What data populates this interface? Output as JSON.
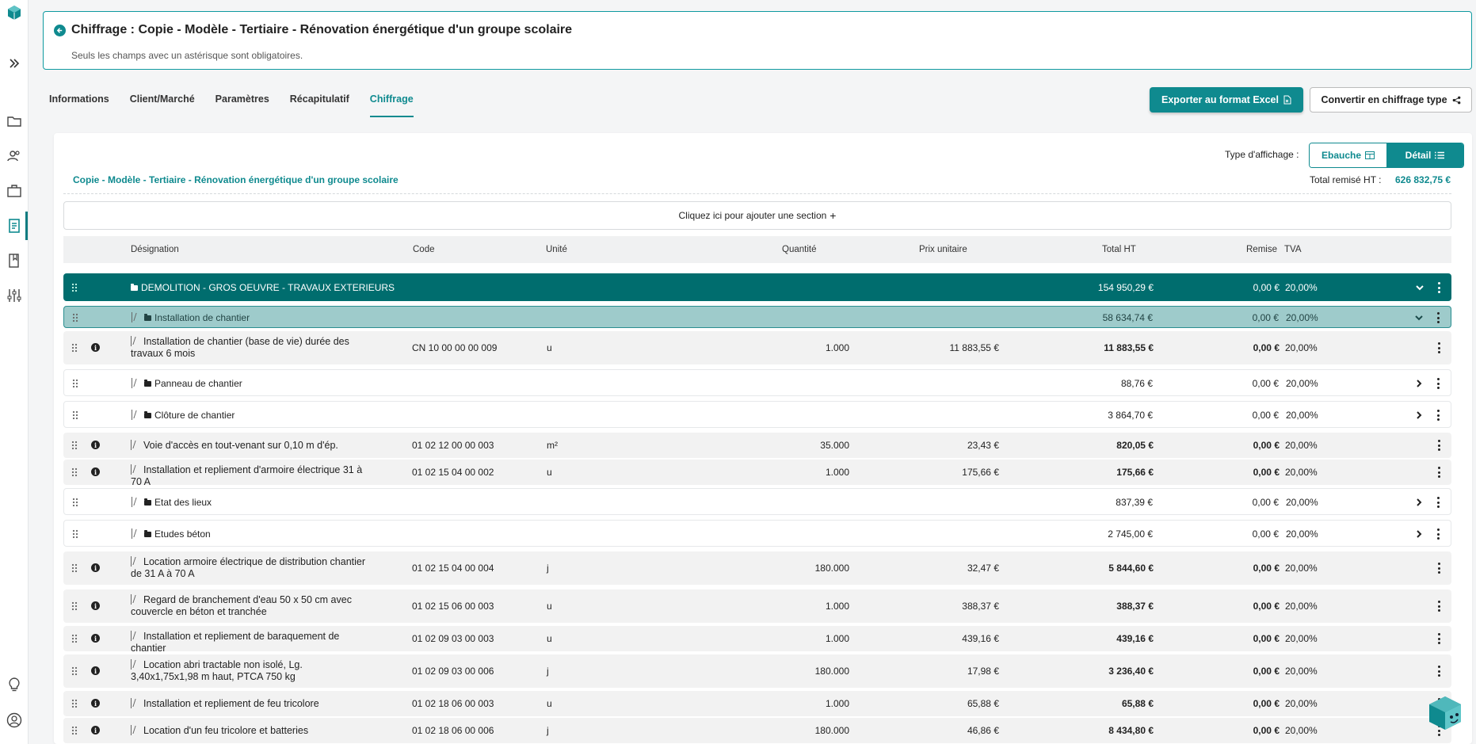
{
  "header": {
    "title": "Chiffrage : Copie - Modèle - Tertiaire - Rénovation énergétique d'un groupe scolaire",
    "subtitle": "Seuls les champs avec un astérisque sont obligatoires."
  },
  "tabs": [
    {
      "label": "Informations"
    },
    {
      "label": "Client/Marché"
    },
    {
      "label": "Paramètres"
    },
    {
      "label": "Récapitulatif"
    },
    {
      "label": "Chiffrage",
      "active": true
    }
  ],
  "toolbar": {
    "export_label": "Exporter au format Excel",
    "convert_label": "Convertir en chiffrage type"
  },
  "display": {
    "label": "Type d'affichage :",
    "option_draft": "Ebauche",
    "option_detail": "Détail",
    "selected": "Détail"
  },
  "project": {
    "name": "Copie - Modèle - Tertiaire - Rénovation énergétique d'un groupe scolaire",
    "total_label": "Total remisé HT :",
    "total_value": "626 832,75 €"
  },
  "add_section_label": "Cliquez ici pour ajouter une section",
  "columns": {
    "designation": "Désignation",
    "code": "Code",
    "unit": "Unité",
    "qty": "Quantité",
    "price": "Prix unitaire",
    "total": "Total HT",
    "discount": "Remise",
    "vat": "TVA"
  },
  "rows": [
    {
      "type": "section",
      "designation": "DEMOLITION - GROS OEUVRE - TRAVAUX EXTERIEURS",
      "total": "154 950,29 €",
      "discount": "0,00 €",
      "vat": "20,00%"
    },
    {
      "type": "subsection",
      "designation": "Installation de chantier",
      "total": "58 634,74 €",
      "discount": "0,00 €",
      "vat": "20,00%"
    },
    {
      "type": "item",
      "designation": "Installation de chantier (base de vie) durée des travaux 6 mois",
      "code": "CN 10 00 00 00 009",
      "unit": "u",
      "qty": "1.000",
      "price": "11 883,55 €",
      "total": "11 883,55 €",
      "discount": "0,00 €",
      "vat": "20,00%"
    },
    {
      "type": "folder",
      "designation": "Panneau de chantier",
      "total": "88,76 €",
      "discount": "0,00 €",
      "vat": "20,00%"
    },
    {
      "type": "folder",
      "designation": "Clôture de chantier",
      "total": "3 864,70 €",
      "discount": "0,00 €",
      "vat": "20,00%"
    },
    {
      "type": "item",
      "designation": "Voie d'accès en tout-venant sur 0,10 m d'ép.",
      "code": "01 02 12 00 00 003",
      "unit": "m²",
      "qty": "35.000",
      "price": "23,43 €",
      "total": "820,05 €",
      "discount": "0,00 €",
      "vat": "20,00%"
    },
    {
      "type": "item",
      "designation": "Installation et repliement d'armoire électrique 31 à 70 A",
      "code": "01 02 15 04 00 002",
      "unit": "u",
      "qty": "1.000",
      "price": "175,66 €",
      "total": "175,66 €",
      "discount": "0,00 €",
      "vat": "20,00%"
    },
    {
      "type": "folder",
      "designation": "Etat des lieux",
      "total": "837,39 €",
      "discount": "0,00 €",
      "vat": "20,00%"
    },
    {
      "type": "folder",
      "designation": "Etudes béton",
      "total": "2 745,00 €",
      "discount": "0,00 €",
      "vat": "20,00%"
    },
    {
      "type": "item",
      "designation": "Location armoire électrique de distribution chantier de 31 A à 70 A",
      "code": "01 02 15 04 00 004",
      "unit": "j",
      "qty": "180.000",
      "price": "32,47 €",
      "total": "5 844,60 €",
      "discount": "0,00 €",
      "vat": "20,00%"
    },
    {
      "type": "item",
      "designation": "Regard de branchement d'eau 50 x 50 cm avec couvercle en béton et tranchée",
      "code": "01 02 15 06 00 003",
      "unit": "u",
      "qty": "1.000",
      "price": "388,37 €",
      "total": "388,37 €",
      "discount": "0,00 €",
      "vat": "20,00%"
    },
    {
      "type": "item",
      "designation": "Installation et repliement de baraquement de chantier",
      "code": "01 02 09 03 00 003",
      "unit": "u",
      "qty": "1.000",
      "price": "439,16 €",
      "total": "439,16 €",
      "discount": "0,00 €",
      "vat": "20,00%"
    },
    {
      "type": "item",
      "designation": "Location abri tractable non isolé, Lg. 3,40x1,75x1,98 m haut, PTCA 750 kg",
      "code": "01 02 09 03 00 006",
      "unit": "j",
      "qty": "180.000",
      "price": "17,98 €",
      "total": "3 236,40 €",
      "discount": "0,00 €",
      "vat": "20,00%"
    },
    {
      "type": "item",
      "designation": "Installation et repliement de feu tricolore",
      "code": "01 02 18 06 00 003",
      "unit": "u",
      "qty": "1.000",
      "price": "65,88 €",
      "total": "65,88 €",
      "discount": "0,00 €",
      "vat": "20,00%"
    },
    {
      "type": "item",
      "designation": "Location d'un feu tricolore et batteries",
      "code": "01 02 18 06 00 006",
      "unit": "j",
      "qty": "180.000",
      "price": "46,86 €",
      "total": "8 434,80 €",
      "discount": "0,00 €",
      "vat": "20,00%"
    }
  ],
  "colors": {
    "accent": "#0f8a8f",
    "section": "#006d6e",
    "subsection": "#9ecbcb"
  }
}
